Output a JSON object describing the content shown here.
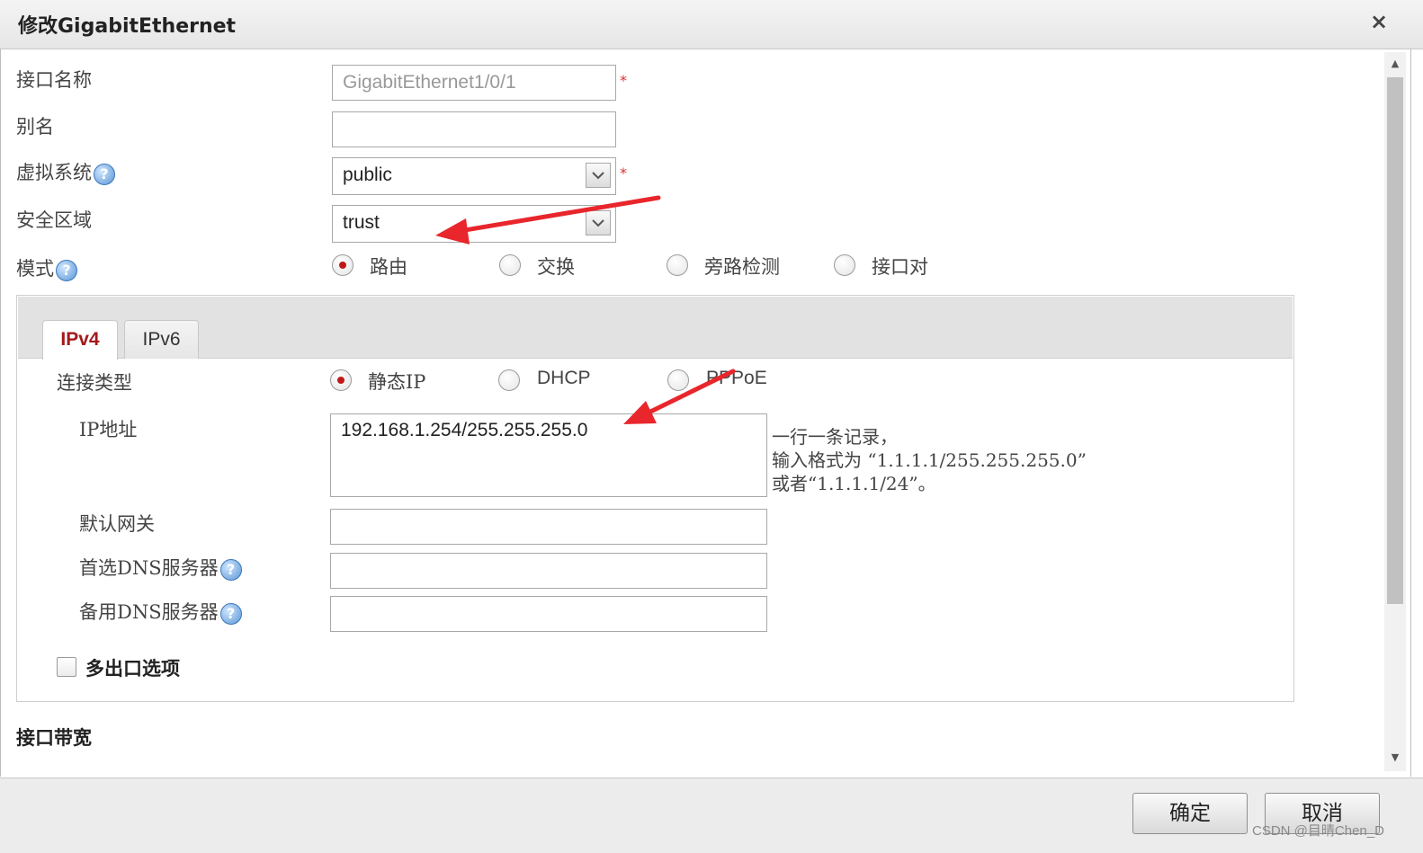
{
  "window": {
    "title": "修改GigabitEthernet",
    "close_icon": "×"
  },
  "form": {
    "interface_name": {
      "label": "接口名称",
      "value": "GigabitEthernet1/0/1"
    },
    "alias": {
      "label": "别名",
      "value": ""
    },
    "virtual_system": {
      "label": "虚拟系统",
      "value": "public"
    },
    "security_zone": {
      "label": "安全区域",
      "value": "trust"
    },
    "mode": {
      "label": "模式",
      "options": [
        "路由",
        "交换",
        "旁路检测",
        "接口对"
      ],
      "selected": "路由"
    },
    "required_mark": "*",
    "help_glyph": "?"
  },
  "ip_panel": {
    "tabs": [
      "IPv4",
      "IPv6"
    ],
    "active_tab": "IPv4",
    "connection_type": {
      "label": "连接类型",
      "options": [
        "静态IP",
        "DHCP",
        "PPPoE"
      ],
      "selected": "静态IP"
    },
    "ip_address": {
      "label": "IP地址",
      "value": "192.168.1.254/255.255.255.0",
      "hint_lines": [
        "一行一条记录，",
        "输入格式为 “1.1.1.1/255.255.255.0”",
        "或者“1.1.1.1/24”。"
      ]
    },
    "default_gateway": {
      "label": "默认网关",
      "value": ""
    },
    "primary_dns": {
      "label": "首选DNS服务器",
      "value": ""
    },
    "secondary_dns": {
      "label": "备用DNS服务器",
      "value": ""
    },
    "multi_egress": {
      "label": "多出口选项",
      "checked": false
    }
  },
  "bandwidth_section": {
    "label": "接口带宽"
  },
  "footer": {
    "ok_label": "确定",
    "cancel_label": "取消"
  },
  "watermark": "CSDN @目晴Chen_D",
  "colors": {
    "accent": "#a3191b",
    "annotation_arrow": "#e8262c",
    "required": "#e03030"
  }
}
